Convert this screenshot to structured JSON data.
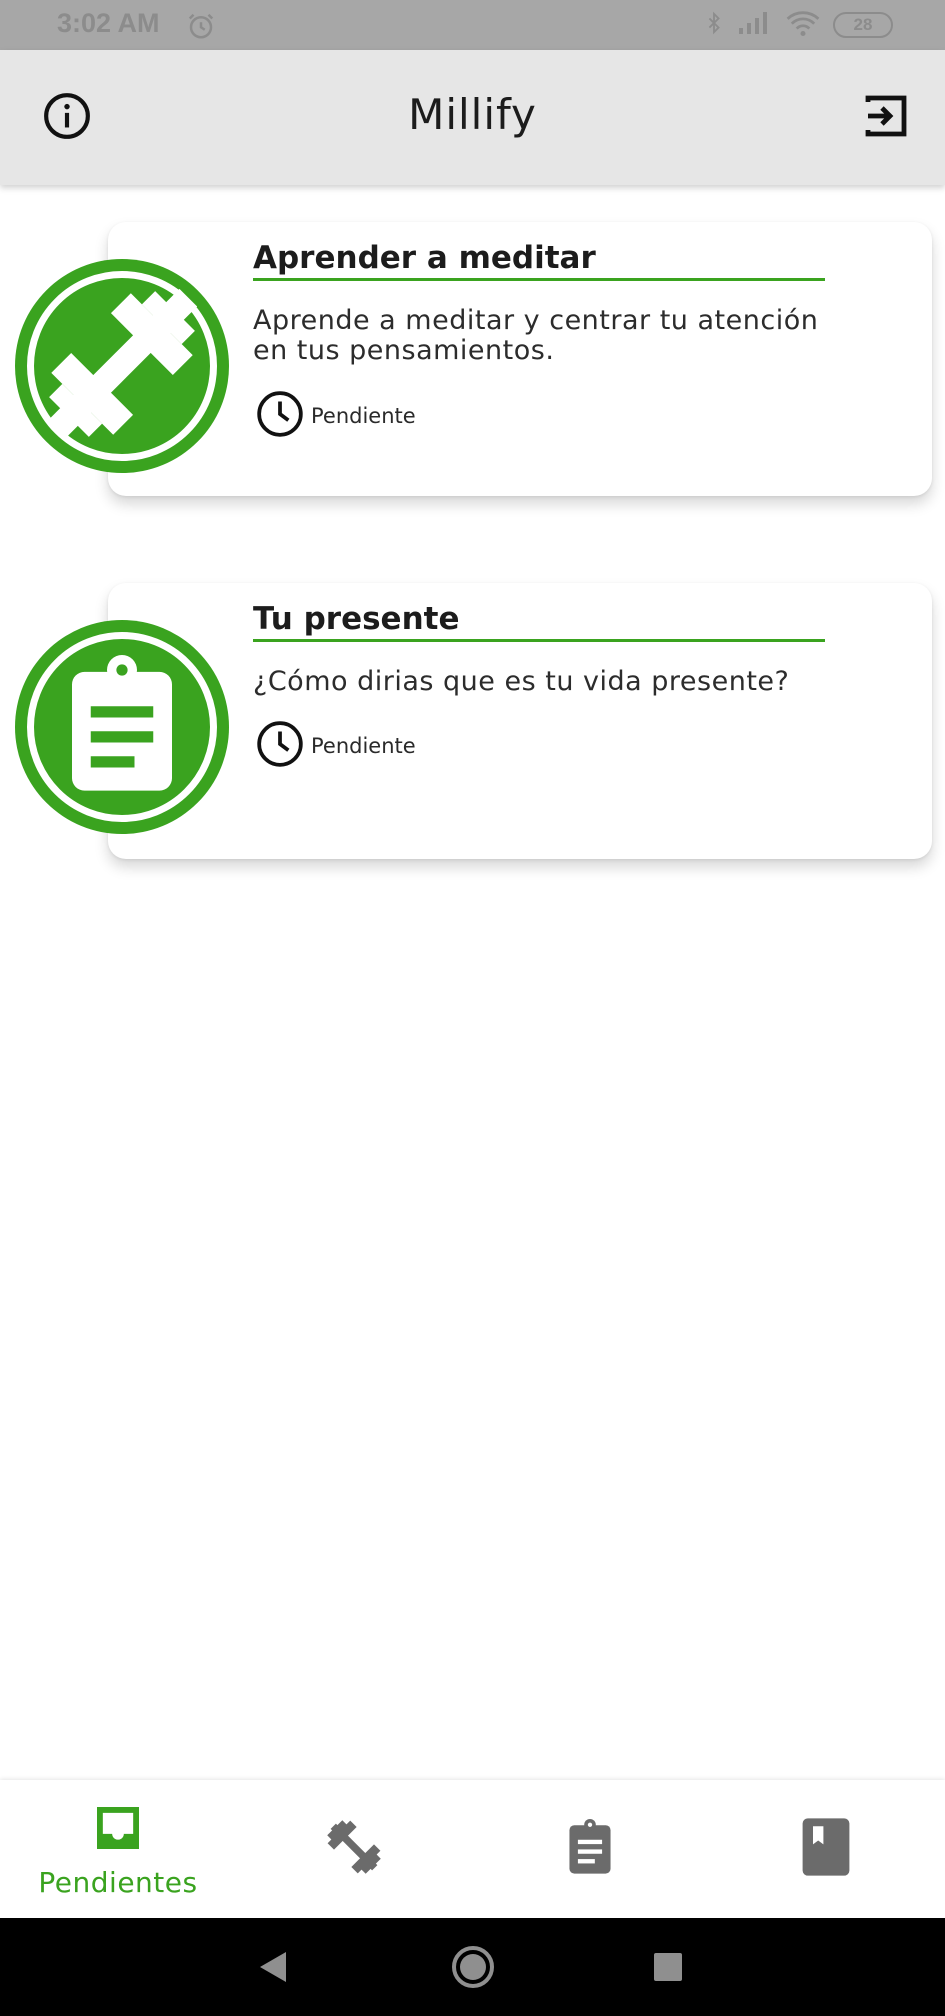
{
  "status_bar": {
    "time": "3:02 AM",
    "battery": "28"
  },
  "app_bar": {
    "title": "Millify",
    "info_icon": "info-icon",
    "logout_icon": "logout-icon"
  },
  "cards": [
    {
      "title": "Aprender a meditar",
      "description": "Aprende a meditar y centrar tu atención en tus pensamientos.",
      "status": "Pendiente",
      "icon": "dumbbell-icon"
    },
    {
      "title": "Tu presente",
      "description": "¿Cómo dirias que es tu vida presente?",
      "status": "Pendiente",
      "icon": "clipboard-icon"
    }
  ],
  "bottom_nav": {
    "items": [
      {
        "label": "Pendientes",
        "icon": "inbox-icon",
        "active": true
      },
      {
        "label": "",
        "icon": "dumbbell-icon",
        "active": false
      },
      {
        "label": "",
        "icon": "clipboard-icon",
        "active": false
      },
      {
        "label": "",
        "icon": "book-icon",
        "active": false
      }
    ]
  },
  "colors": {
    "accent": "#3aa31f",
    "inactive": "#6b6b6b",
    "app_bar": "#e6e6e6"
  }
}
